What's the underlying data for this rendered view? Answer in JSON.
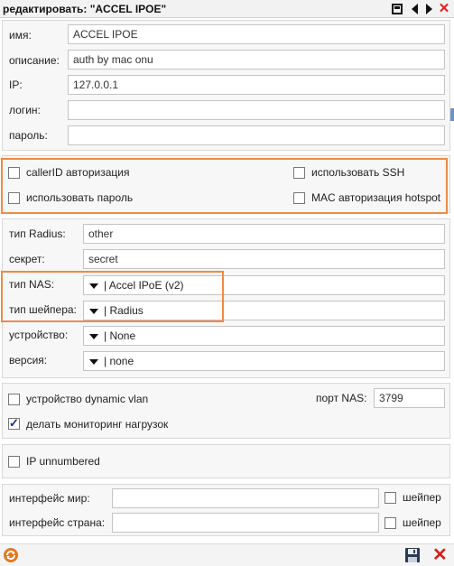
{
  "window": {
    "title": "редактировать: \"ACCEL IPOE\"",
    "icons": [
      "window-icon",
      "arrow-left-icon",
      "arrow-right-icon",
      "close-icon"
    ]
  },
  "basic": {
    "name_label": "имя:",
    "name_value": "ACCEL IPOE",
    "description_label": "описание:",
    "description_value": "auth by mac onu",
    "ip_label": "IP:",
    "ip_value": "127.0.0.1",
    "login_label": "логин:",
    "login_value": "",
    "password_label": "пароль:",
    "password_value": ""
  },
  "auth_options": {
    "callerid": {
      "label": "callerID авторизация",
      "checked": false
    },
    "use_ssh": {
      "label": "использовать SSH",
      "checked": false
    },
    "use_password": {
      "label": "использовать пароль",
      "checked": false
    },
    "mac_hotspot": {
      "label": "MAC авторизация hotspot",
      "checked": false
    }
  },
  "radius": {
    "type_label": "тип Radius:",
    "type_value": "other",
    "secret_label": "секрет:",
    "secret_value": "secret",
    "nas_type_label": "тип NAS:",
    "nas_type_value": "| Accel IPoE (v2)",
    "shaper_type_label": "тип шейпера:",
    "shaper_type_value": "| Radius",
    "device_label": "устройство:",
    "device_value": "| None",
    "version_label": "версия:",
    "version_value": "| none"
  },
  "monitoring": {
    "dynamic_vlan": {
      "label": "устройство dynamic vlan",
      "checked": false
    },
    "load_monitoring": {
      "label": "делать мониторинг нагрузок",
      "checked": true
    },
    "nas_port_label": "порт NAS:",
    "nas_port_value": "3799"
  },
  "ip_unnumbered": {
    "label": "IP unnumbered",
    "checked": false
  },
  "interfaces": {
    "world_label": "интерфейс мир:",
    "world_value": "",
    "world_shaper_label": "шейпер",
    "country_label": "интерфейс страна:",
    "country_value": "",
    "country_shaper_label": "шейпер"
  },
  "colors": {
    "highlight": "#ec8a4a",
    "refresh": "#e07a1f",
    "delete": "#d22222",
    "save": "#2a3a55"
  },
  "bottom": {
    "icons": [
      "refresh-icon",
      "save-icon",
      "delete-icon"
    ]
  }
}
